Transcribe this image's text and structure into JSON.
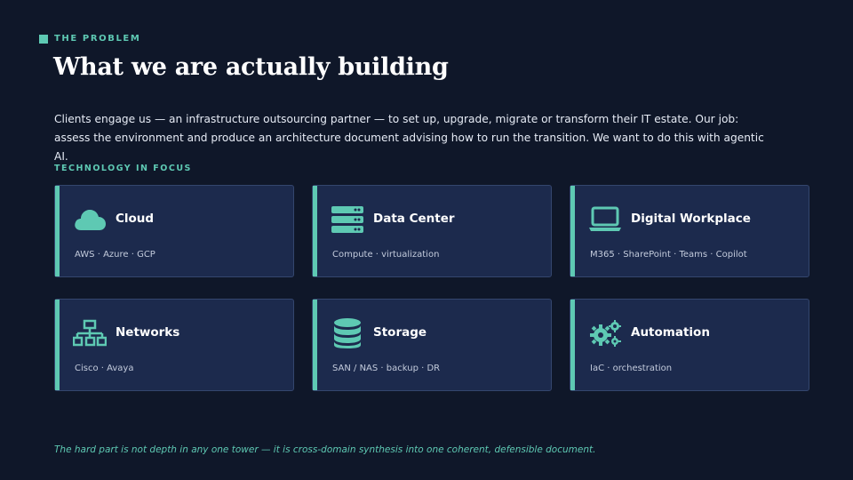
{
  "eyebrow": "THE PROBLEM",
  "title": "What we are actually building",
  "intro": "Clients engage us — an infrastructure outsourcing partner — to set up, upgrade, migrate or transform their IT estate. Our job: assess the environment and produce an architecture document advising how to run the transition. We want to do this with agentic AI.",
  "section_label": "TECHNOLOGY IN FOCUS",
  "cards": [
    {
      "name": "Cloud",
      "sub": "AWS · Azure · GCP",
      "icon": "cloud-icon"
    },
    {
      "name": "Data Center",
      "sub": "Compute · virtualization",
      "icon": "server-icon"
    },
    {
      "name": "Digital Workplace",
      "sub": "M365 · SharePoint · Teams · Copilot",
      "icon": "laptop-icon"
    },
    {
      "name": "Networks",
      "sub": "Cisco · Avaya",
      "icon": "network-icon"
    },
    {
      "name": "Storage",
      "sub": "SAN / NAS · backup · DR",
      "icon": "database-icon"
    },
    {
      "name": "Automation",
      "sub": "IaC · orchestration",
      "icon": "gears-icon"
    }
  ],
  "footer": "The hard part is not depth in any one tower — it is cross-domain synthesis into one coherent, defensible document.",
  "colors": {
    "background": "#0f1729",
    "accent": "#5ec9b3",
    "card": "#1c2a4d"
  }
}
